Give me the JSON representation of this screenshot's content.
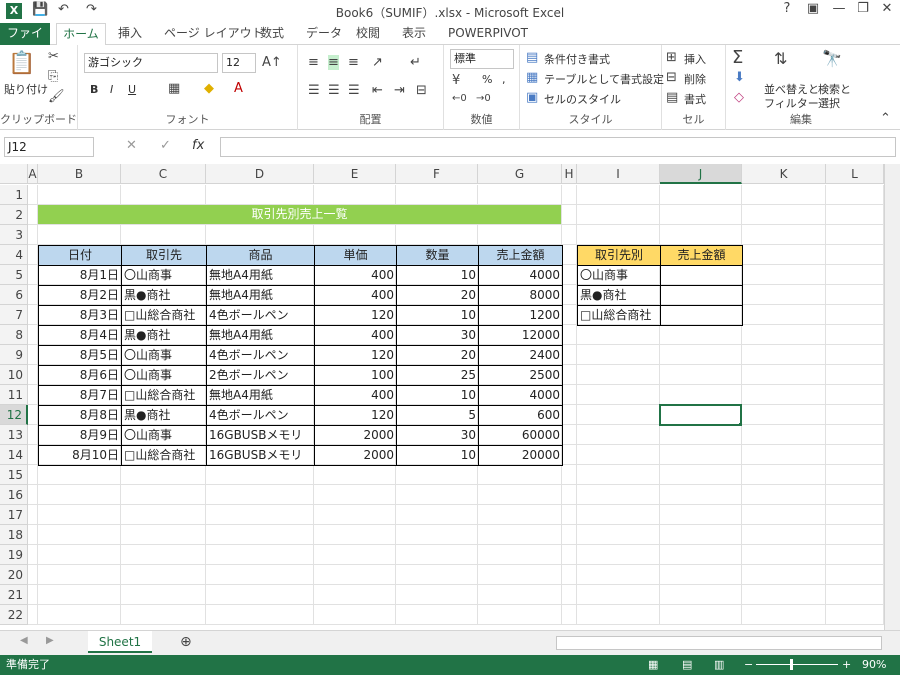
{
  "titlebar": {
    "title": "Book6（SUMIF）.xlsx - Microsoft Excel",
    "help": "?",
    "minimize": "—",
    "restore": "❐",
    "close": "✕"
  },
  "tabs": [
    "ファイル",
    "ホーム",
    "挿入",
    "ページ レイアウト",
    "数式",
    "データ",
    "校閲",
    "表示",
    "POWERPIVOT"
  ],
  "ribbon": {
    "clipboard": {
      "paste": "貼り付け",
      "label": "クリップボード"
    },
    "font": {
      "name": "游ゴシック",
      "size": "12",
      "bold": "B",
      "italic": "I",
      "underline": "U",
      "label": "フォント"
    },
    "alignment": {
      "label": "配置"
    },
    "number": {
      "format": "標準",
      "percent": "%",
      "comma": ",",
      "label": "数値"
    },
    "styles": {
      "conditional": "条件付き書式",
      "table": "テーブルとして書式設定",
      "cell": "セルのスタイル",
      "label": "スタイル"
    },
    "cells": {
      "insert": "挿入",
      "delete": "削除",
      "format": "書式",
      "label": "セル"
    },
    "editing": {
      "sort": "並べ替えと",
      "filter": "フィルター",
      "find": "検索と",
      "select": "選択",
      "label": "編集"
    }
  },
  "formula_bar": {
    "namebox": "J12",
    "fx": "fx"
  },
  "columns": [
    "A",
    "B",
    "C",
    "D",
    "E",
    "F",
    "G",
    "H",
    "I",
    "J",
    "K",
    "L"
  ],
  "rows": [
    "1",
    "2",
    "3",
    "4",
    "5",
    "6",
    "7",
    "8",
    "9",
    "10",
    "11",
    "12",
    "13",
    "14",
    "15",
    "16",
    "17",
    "18",
    "19",
    "20",
    "21",
    "22"
  ],
  "sheet": {
    "title": "取引先別売上一覧",
    "headers": [
      "日付",
      "取引先",
      "商品",
      "単価",
      "数量",
      "売上金額"
    ],
    "data": [
      [
        "8月1日",
        "〇山商事",
        "無地A4用紙",
        "400",
        "10",
        "4000"
      ],
      [
        "8月2日",
        "黒●商社",
        "無地A4用紙",
        "400",
        "20",
        "8000"
      ],
      [
        "8月3日",
        "□山総合商社",
        "4色ボールペン",
        "120",
        "10",
        "1200"
      ],
      [
        "8月4日",
        "黒●商社",
        "無地A4用紙",
        "400",
        "30",
        "12000"
      ],
      [
        "8月5日",
        "〇山商事",
        "4色ボールペン",
        "120",
        "20",
        "2400"
      ],
      [
        "8月6日",
        "〇山商事",
        "2色ボールペン",
        "100",
        "25",
        "2500"
      ],
      [
        "8月7日",
        "□山総合商社",
        "無地A4用紙",
        "400",
        "10",
        "4000"
      ],
      [
        "8月8日",
        "黒●商社",
        "4色ボールペン",
        "120",
        "5",
        "600"
      ],
      [
        "8月9日",
        "〇山商事",
        "16GBUSBメモリ",
        "2000",
        "30",
        "60000"
      ],
      [
        "8月10日",
        "□山総合商社",
        "16GBUSBメモリ",
        "2000",
        "10",
        "20000"
      ]
    ],
    "summary_headers": [
      "取引先別",
      "売上金額"
    ],
    "summary_rows": [
      "〇山商事",
      "黒●商社",
      "□山総合商社"
    ]
  },
  "sheettabs": {
    "active": "Sheet1",
    "add": "⊕"
  },
  "status": {
    "ready": "準備完了",
    "zoom": "90%"
  }
}
